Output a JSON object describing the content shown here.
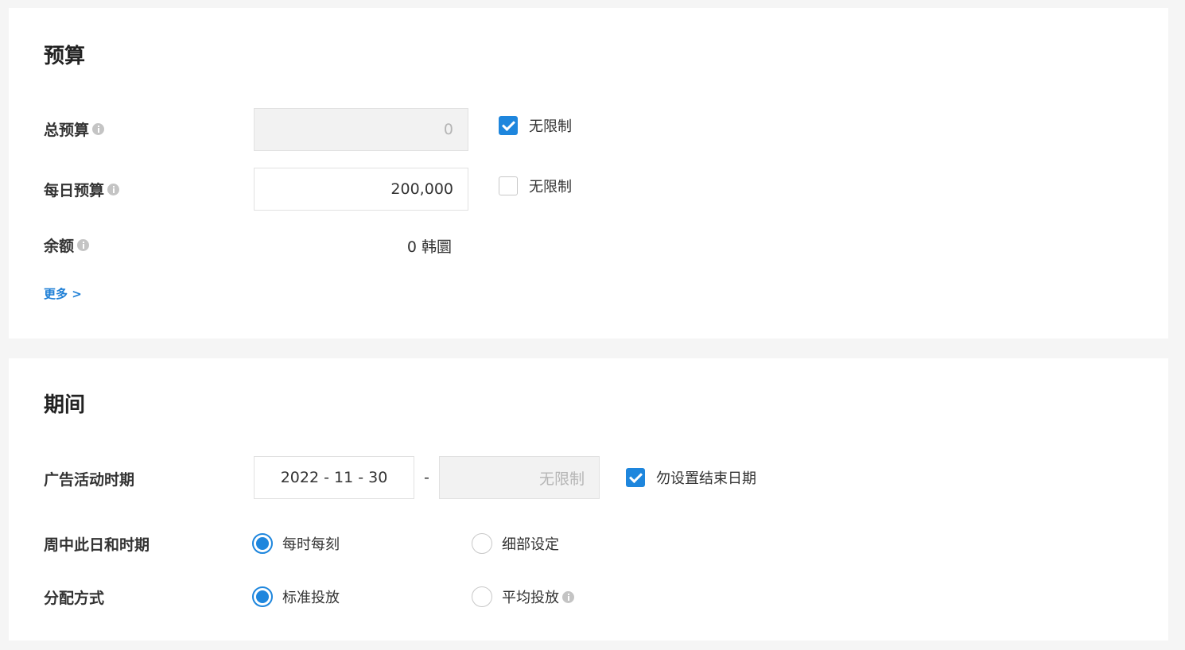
{
  "budget": {
    "title": "预算",
    "total": {
      "label": "总预算",
      "value": "0",
      "unlimited_label": "无限制",
      "unlimited_checked": true
    },
    "daily": {
      "label": "每日预算",
      "value": "200,000",
      "unlimited_label": "无限制",
      "unlimited_checked": false
    },
    "balance": {
      "label": "余额",
      "value": "0 韩圜"
    },
    "more_label": "更多 >"
  },
  "period": {
    "title": "期间",
    "campaign_period": {
      "label": "广告活动时期",
      "start_date": "2022 - 11 - 30",
      "separator": "-",
      "end_date_placeholder": "无限制",
      "no_end_label": "勿设置结束日期",
      "no_end_checked": true
    },
    "weekday_time": {
      "label": "周中此日和时期",
      "options": [
        {
          "label": "每时每刻",
          "selected": true
        },
        {
          "label": "细部设定",
          "selected": false
        }
      ]
    },
    "delivery": {
      "label": "分配方式",
      "options": [
        {
          "label": "标准投放",
          "selected": true
        },
        {
          "label": "平均投放",
          "selected": false
        }
      ]
    }
  },
  "colors": {
    "accent": "#1e86dd",
    "link": "#1e7fd6",
    "page_bg": "#f5f5f5",
    "disabled_bg": "#f2f2f2"
  }
}
